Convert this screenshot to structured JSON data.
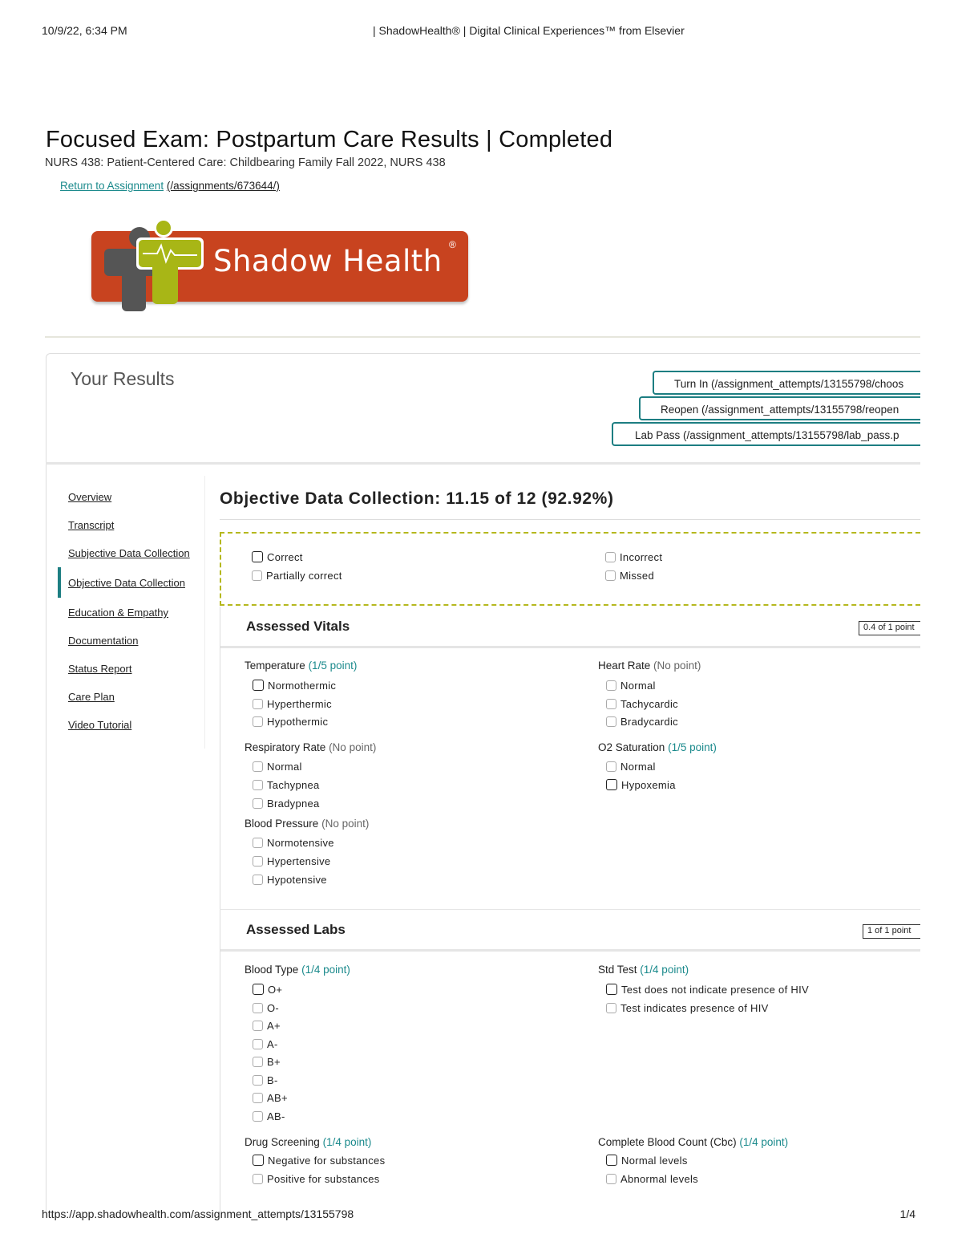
{
  "print_header": {
    "date": "10/9/22, 6:34 PM",
    "title": "| ShadowHealth® | Digital Clinical Experiences™ from Elsevier"
  },
  "print_footer": {
    "url": "https://app.shadowhealth.com/assignment_attempts/13155798",
    "page": "1/4"
  },
  "page": {
    "title": "Focused Exam: Postpartum Care Results | Completed",
    "course": "NURS 438: Patient-Centered Care: Childbearing Family Fall 2022, NURS 438",
    "return_link": {
      "label": "Return to Assignment",
      "path": "(/assignments/673644/)"
    }
  },
  "logo": {
    "text": "Shadow Health",
    "reg": "®"
  },
  "results": {
    "heading": "Your Results",
    "buttons": {
      "turn_in": "Turn In (/assignment_attempts/13155798/choos",
      "reopen": "Reopen (/assignment_attempts/13155798/reopen",
      "lab_pass": "Lab Pass (/assignment_attempts/13155798/lab_pass.p"
    }
  },
  "nav": {
    "items": [
      {
        "label": "Overview"
      },
      {
        "label": "Transcript"
      },
      {
        "label": "Subjective Data Collection"
      },
      {
        "label": "Objective Data Collection"
      },
      {
        "label": "Education & Empathy"
      },
      {
        "label": "Documentation"
      },
      {
        "label": "Status Report"
      },
      {
        "label": "Care Plan"
      },
      {
        "label": "Video Tutorial"
      }
    ],
    "active_index": 3
  },
  "section": {
    "title": "Objective Data Collection: 11.15 of 12 (92.92%)"
  },
  "legend": {
    "correct": "Correct",
    "partially_correct": "Partially correct",
    "incorrect": "Incorrect",
    "missed": "Missed"
  },
  "vitals": {
    "title": "Assessed Vitals",
    "score": "0.4 of 1 point",
    "temperature": {
      "label": "Temperature",
      "points": "(1/5 point)",
      "options": [
        "Normothermic",
        "Hyperthermic",
        "Hypothermic"
      ]
    },
    "heart_rate": {
      "label": "Heart Rate",
      "points": "(No point)",
      "options": [
        "Normal",
        "Tachycardic",
        "Bradycardic"
      ]
    },
    "respiratory_rate": {
      "label": "Respiratory Rate",
      "points": "(No point)",
      "options": [
        "Normal",
        "Tachypnea",
        "Bradypnea"
      ]
    },
    "o2_saturation": {
      "label": "O2 Saturation",
      "points": "(1/5 point)",
      "options": [
        "Normal",
        "Hypoxemia"
      ]
    },
    "blood_pressure": {
      "label": "Blood Pressure",
      "points": "(No point)",
      "options": [
        "Normotensive",
        "Hypertensive",
        "Hypotensive"
      ]
    }
  },
  "labs": {
    "title": "Assessed Labs",
    "score": "1 of 1 point",
    "blood_type": {
      "label": "Blood Type",
      "points": "(1/4 point)",
      "options": [
        "O+",
        "O-",
        "A+",
        "A-",
        "B+",
        "B-",
        "AB+",
        "AB-"
      ]
    },
    "std_test": {
      "label": "Std Test",
      "points": "(1/4 point)",
      "options": [
        "Test does not indicate presence of HIV",
        "Test indicates presence of HIV"
      ]
    },
    "drug_screening": {
      "label": "Drug Screening",
      "points": "(1/4 point)",
      "options": [
        "Negative for substances",
        "Positive for substances"
      ]
    },
    "cbc": {
      "label": "Complete Blood Count (Cbc)",
      "points": "(1/4 point)",
      "options": [
        "Normal levels",
        "Abnormal levels"
      ]
    }
  }
}
